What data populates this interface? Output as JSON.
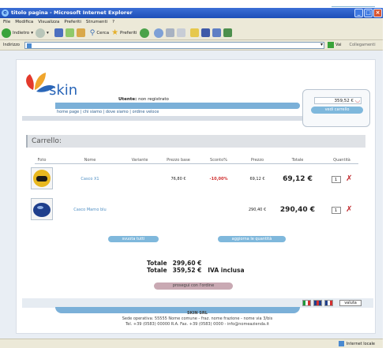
{
  "window": {
    "title": "titolo pagina - Microsoft Internet Explorer",
    "menu": [
      "File",
      "Modifica",
      "Visualizza",
      "Preferiti",
      "Strumenti",
      "?"
    ],
    "toolbar": {
      "back": "Indietro",
      "search": "Cerca",
      "favorites": "Preferiti"
    },
    "address_label": "Indirizzo",
    "go_label": "Vai",
    "links_label": "Collegamenti",
    "status_zone": "Internet locale"
  },
  "site": {
    "logo_text": "skin",
    "user_label": "Utente:",
    "user_value": "non registrato",
    "nav": "home page | chi siamo | dove siamo | ordine veloce",
    "cart_total": "359,52 €",
    "cart_button": "vedi carrello",
    "section_title": "Carrello:"
  },
  "cart": {
    "headers": [
      "Foto",
      "Nome",
      "Variante",
      "Prezzo base",
      "Sconto%",
      "Prezzo",
      "Totale",
      "Quantità"
    ],
    "rows": [
      {
        "name": "Casco X1",
        "variant": "",
        "base": "76,80 €",
        "discount": "-10,00%",
        "price": "69,12 €",
        "total": "69,12 €",
        "qty": "1"
      },
      {
        "name": "Casco Marno blu",
        "variant": "",
        "base": "",
        "discount": "",
        "price": "290,40 €",
        "total": "290,40 €",
        "qty": "1"
      }
    ]
  },
  "buttons": {
    "clear": "svuota tutti",
    "update": "aggiorna le quantità",
    "proceed": "prosegui con l'ordine",
    "currency": "valuta"
  },
  "totals": {
    "label": "Totale",
    "net": "299,60 €",
    "gross": "359,52 €",
    "vat_note": "IVA inclusa"
  },
  "footer": {
    "company": "SKIN SRL",
    "address": "Sede operativa: 55555 Nome comune - fraz. nome frazione - nome via 3/bis",
    "contacts": "Tel. +39 (0583) 00000 R.A. Fax. +39 (0583) 0000 - info@nomeazienda.it"
  },
  "colors": {
    "accent": "#7fb8dc",
    "brand": "#2a66b8",
    "discount": "#d03030",
    "delete": "#c0282d"
  }
}
